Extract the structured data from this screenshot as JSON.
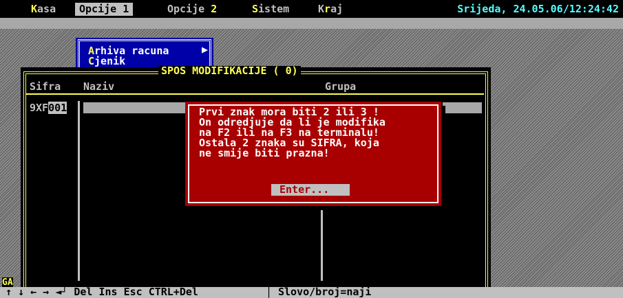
{
  "menubar": {
    "items": [
      {
        "hot": "K",
        "rest": "asa"
      },
      {
        "pre": "Opcije ",
        "hot": "1"
      },
      {
        "pre": "Opcije ",
        "hot": "2"
      },
      {
        "hot": "S",
        "rest": "istem"
      },
      {
        "pre": "K",
        "hot": "r",
        "rest": "aj"
      }
    ],
    "clock": "Srijeda, 24.05.06/12:24:42"
  },
  "submenu": {
    "items": [
      {
        "hot": "A",
        "rest": "rhiva racuna"
      },
      {
        "hot": "C",
        "rest": "jenik"
      }
    ],
    "arrow": "▶"
  },
  "window": {
    "title": "SPOS MODIFIKACIJE (     0)",
    "columns": {
      "sifra": "Sifra",
      "naziv": "Naziv",
      "grupa": "Grupa"
    },
    "row": {
      "prefix": "9XF",
      "input": "001"
    }
  },
  "dialog": {
    "message": "Prvi znak mora biti 2 ili 3 !\nOn odredjuje da li je modifika\nna F2 ili na F3 na terminalu!\nOstala 2 znaka su SIFRA, koja\nne smije biti prazna!",
    "button": "Enter..."
  },
  "side_label": "GA",
  "statusbar": {
    "keys": "↑ ↓ ← → ◄┘ Del Ins Esc CTRL+Del",
    "hint": "Slovo/broj=naji"
  },
  "colors": {
    "dialog_bg": "#a80000",
    "window_frame": "#ffff55",
    "submenu_bg": "#0000a8",
    "clock": "#55ffff"
  }
}
